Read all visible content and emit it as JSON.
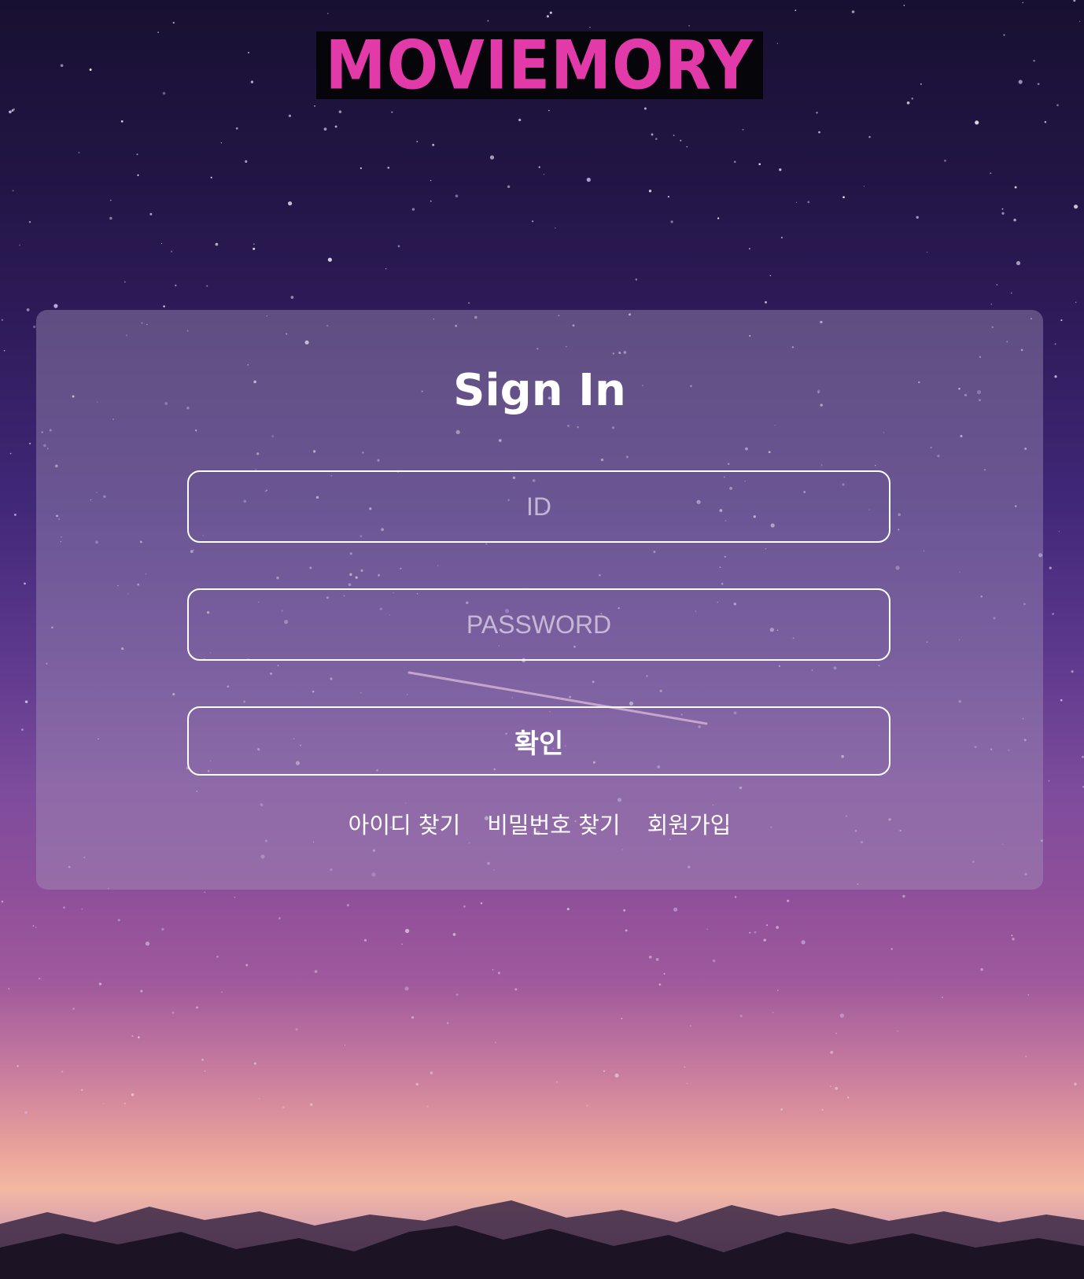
{
  "brand": {
    "logo_text": "MOVIEMORY",
    "logo_color": "#e23aa8",
    "logo_background": "#05050a"
  },
  "login": {
    "title": "Sign In",
    "id_placeholder": "ID",
    "password_placeholder": "PASSWORD",
    "confirm_label": "확인",
    "links": {
      "find_id": "아이디 찾기",
      "find_password": "비밀번호 찾기",
      "signup": "회원가입"
    }
  }
}
